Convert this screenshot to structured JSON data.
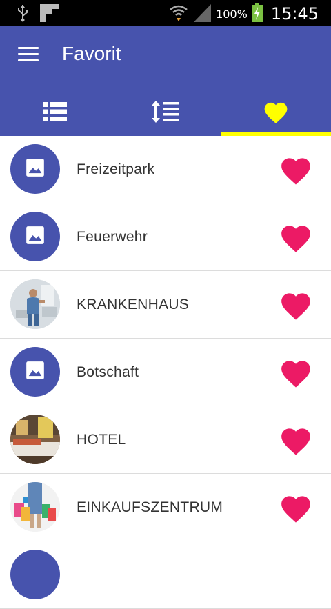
{
  "status_bar": {
    "battery_percent": "100%",
    "time": "15:45",
    "icons": [
      "usb-icon",
      "notification-icon",
      "wifi-icon",
      "signal-icon",
      "battery-charging-icon"
    ]
  },
  "app_bar": {
    "title": "Favorit",
    "menu_icon": "hamburger-menu-icon"
  },
  "tabs": [
    {
      "icon": "list-view-icon",
      "active": false
    },
    {
      "icon": "sort-list-icon",
      "active": false
    },
    {
      "icon": "favorite-heart-icon",
      "active": true
    }
  ],
  "colors": {
    "primary": "#4753ad",
    "tab_indicator": "#ffff00",
    "active_tab_icon": "#ffff00",
    "heart": "#ec1a65",
    "text": "#333333"
  },
  "favorites": [
    {
      "label": "Freizeitpark",
      "thumbnail": "placeholder-image-icon",
      "favorited": true
    },
    {
      "label": "Feuerwehr",
      "thumbnail": "placeholder-image-icon",
      "favorited": true
    },
    {
      "label": "KRANKENHAUS",
      "thumbnail": "hospital-photo",
      "favorited": true
    },
    {
      "label": "Botschaft",
      "thumbnail": "placeholder-image-icon",
      "favorited": true
    },
    {
      "label": "HOTEL",
      "thumbnail": "hotel-room-photo",
      "favorited": true
    },
    {
      "label": "EINKAUFSZENTRUM",
      "thumbnail": "shopping-bags-photo",
      "favorited": true
    }
  ]
}
